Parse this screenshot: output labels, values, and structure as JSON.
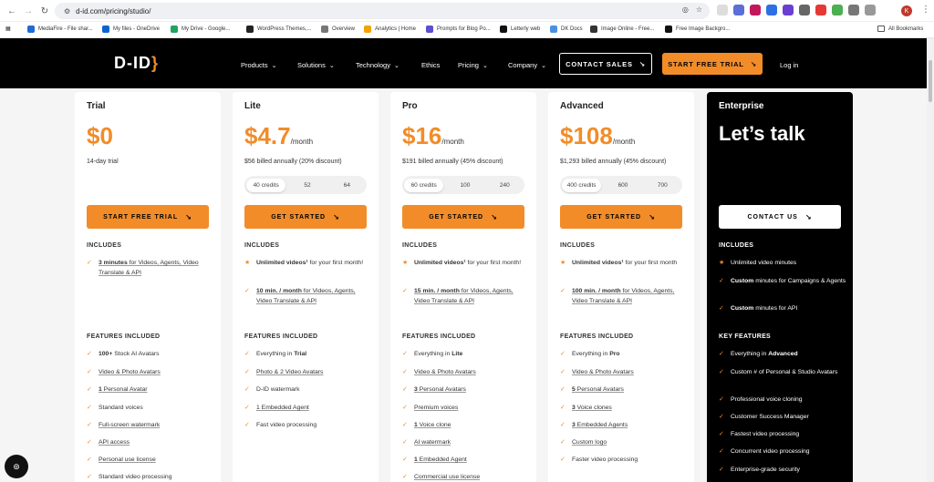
{
  "browser": {
    "url": "d-id.com/pricing/studio/",
    "profile_initial": "K",
    "bookmarks": [
      {
        "label": "MediaFire - File shar...",
        "color": "#1e6bd6"
      },
      {
        "label": "My files - OneDrive",
        "color": "#0a64d0"
      },
      {
        "label": "My Drive - Google...",
        "color": "#1fa463"
      },
      {
        "label": "WordPress Themes,...",
        "color": "#222222"
      },
      {
        "label": "Overview",
        "color": "#777777"
      },
      {
        "label": "Analytics | Home",
        "color": "#f4a200"
      },
      {
        "label": "Prompts for Blog Po...",
        "color": "#5a4fcf"
      },
      {
        "label": "Letterly web",
        "color": "#111111"
      },
      {
        "label": "DK Docs",
        "color": "#4a90e2"
      },
      {
        "label": "Image Online - Free...",
        "color": "#333333"
      },
      {
        "label": "Free Image Backgro...",
        "color": "#111111"
      }
    ],
    "all_bookmarks": "All Bookmarks"
  },
  "header": {
    "logo": "D-ID",
    "nav": [
      "Products",
      "Solutions",
      "Technology",
      "Ethics",
      "Pricing",
      "Company"
    ],
    "contact_sales": "CONTACT SALES",
    "start_trial": "START FREE TRIAL",
    "login": "Log in"
  },
  "cards": [
    {
      "plan": "Trial",
      "price": "$0",
      "per": "",
      "billed": "14-day trial",
      "cta": "START FREE TRIAL",
      "includes_head": "INCLUDES",
      "features_head": "FEATURES INCLUDED"
    },
    {
      "plan": "Lite",
      "price": "$4.7",
      "per": "/month",
      "billed": "$56 billed annually (20% discount)",
      "credits": [
        "40 credits",
        "52",
        "64"
      ],
      "cta": "GET STARTED",
      "includes_head": "INCLUDES",
      "features_head": "FEATURES INCLUDED"
    },
    {
      "plan": "Pro",
      "price": "$16",
      "per": "/month",
      "billed": "$191 billed annually (45% discount)",
      "credits": [
        "60 credits",
        "100",
        "240"
      ],
      "cta": "GET STARTED",
      "includes_head": "INCLUDES",
      "features_head": "FEATURES INCLUDED"
    },
    {
      "plan": "Advanced",
      "price": "$108",
      "per": "/month",
      "billed": "$1,293 billed annually (45% discount)",
      "credits": [
        "400 credits",
        "600",
        "700"
      ],
      "cta": "GET STARTED",
      "includes_head": "INCLUDES",
      "features_head": "FEATURES INCLUDED"
    },
    {
      "plan": "Enterprise",
      "price": "Let’s talk",
      "cta": "CONTACT US",
      "includes_head": "INCLUDES",
      "features_head": "KEY FEATURES"
    }
  ]
}
